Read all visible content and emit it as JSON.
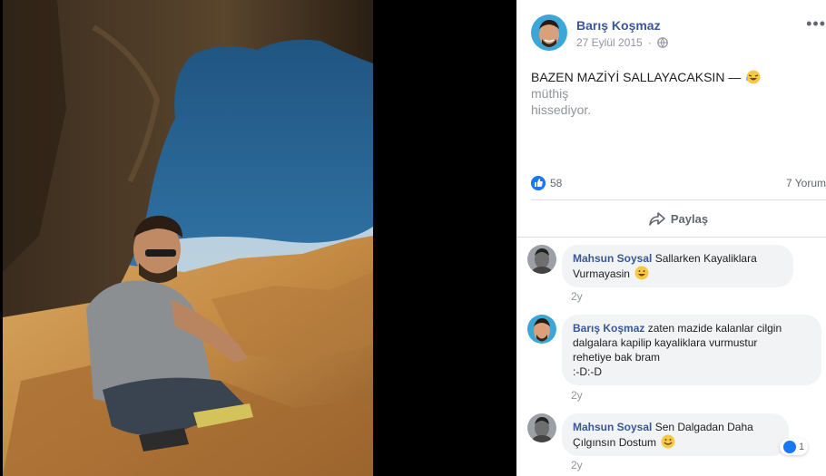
{
  "post": {
    "author": "Barış Koşmaz",
    "date": "27 Eylül 2015",
    "text": "BAZEN MAZİYİ SALLAYACAKSIN —",
    "feeling_line1": "müthiş",
    "feeling_line2": "hissediyor.",
    "likes": "58",
    "comments_count": "7 Yorum",
    "share_label": "Paylaş",
    "more_label": "•••"
  },
  "comments": [
    {
      "name": "Mahsun Soysal",
      "text1": "Sallarken Kayaliklara",
      "text2": "Vurmayasin",
      "time": "2y"
    },
    {
      "name": "Barış Koşmaz",
      "text1": "zaten mazide kalanlar cilgin",
      "text2": "dalgalara kapilip kayaliklara vurmustur",
      "text3": "rehetiye bak bram",
      "text4": ":-D:-D",
      "time": "2y"
    },
    {
      "name": "Mahsun Soysal",
      "text1": "Sen Dalgadan Daha",
      "text2": "Çılgınsın Dostum",
      "time": "2y",
      "likes": "1"
    }
  ],
  "colors": {
    "link_blue": "#385898",
    "like_blue": "#1877f2",
    "bubble_gray": "#f2f3f5",
    "meta_gray": "#90949c"
  },
  "icons": [
    "globe-icon",
    "like-icon",
    "share-icon",
    "smile-emoji-icon",
    "laughing-emoji-icon"
  ]
}
